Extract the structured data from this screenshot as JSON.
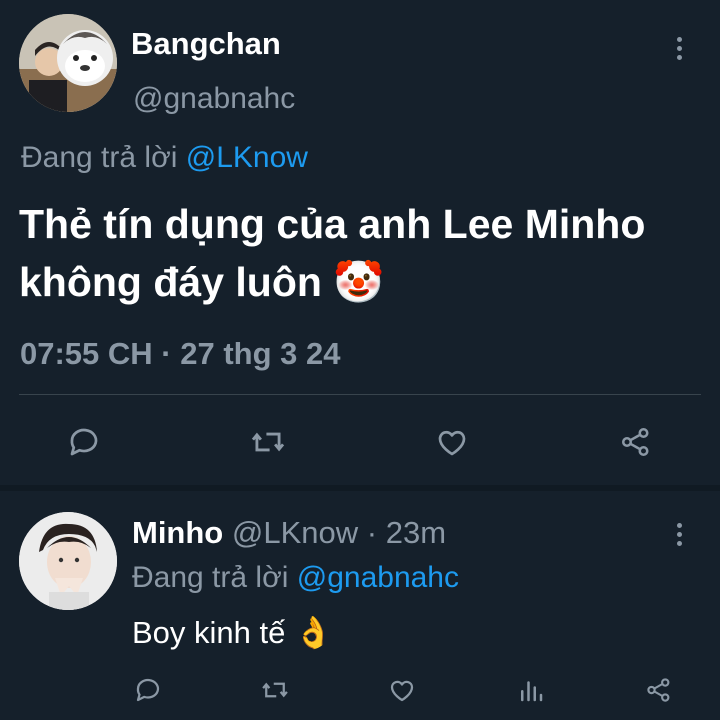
{
  "main_tweet": {
    "display_name": "Bangchan",
    "handle": "@gnabnahc",
    "reply_prefix": "Đang trả lời",
    "reply_to": "@LKnow",
    "text": "Thẻ tín dụng của anh Lee Minho không đáy luôn",
    "emoji": "🤡",
    "timestamp": "07:55 CH · 27 thg 3 24"
  },
  "reply_tweet": {
    "display_name": "Minho",
    "handle": "@LKnow",
    "separator": "·",
    "time_ago": "23m",
    "reply_prefix": "Đang trả lời",
    "reply_to": "@gnabnahc",
    "text": "Boy kinh tế",
    "emoji": "👌"
  },
  "colors": {
    "background": "#15202b",
    "muted": "#8b98a5",
    "link": "#1d9bf0",
    "divider": "#38444d"
  },
  "icons": [
    "comment-icon",
    "retweet-icon",
    "like-icon",
    "analytics-icon",
    "share-icon",
    "kebab-menu-icon"
  ]
}
